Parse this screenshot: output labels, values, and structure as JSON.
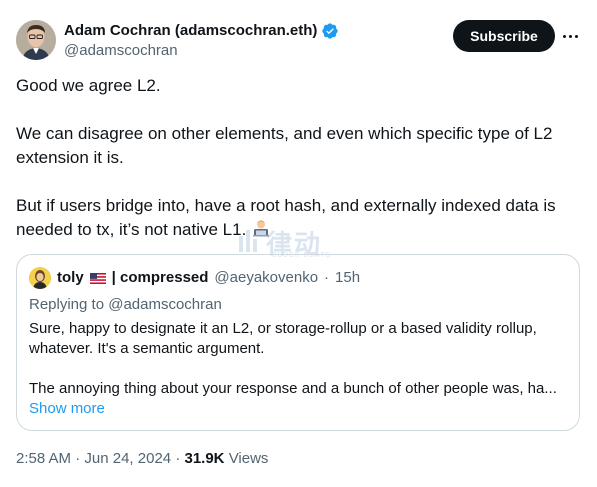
{
  "author": {
    "display_name": "Adam Cochran (adamscochran.eth)",
    "handle": "@adamscochran"
  },
  "actions": {
    "subscribe_label": "Subscribe"
  },
  "tweet": {
    "paragraphs": [
      "Good we agree L2.",
      "We can disagree on other elements, and even which specific type of L2 extension it is.",
      "But if users bridge into, have a root hash, and externally indexed data is needed to tx, it’s not native L1."
    ],
    "emoji": "man-technologist",
    "watermark_text": "律动",
    "watermark_sub": "BLOCK BEATS"
  },
  "quoted": {
    "display_name": "toly",
    "flag": "us-flag",
    "name_suffix": "| compressed",
    "handle": "@aeyakovenko",
    "separator": "·",
    "time": "15h",
    "replying_to": "Replying to @adamscochran",
    "paragraphs": [
      "Sure, happy to designate it an L2, or storage-rollup or a based validity rollup, whatever.  It's a semantic argument.",
      "The annoying thing about your response and a bunch of other people was, ha..."
    ],
    "show_more": "Show more"
  },
  "meta": {
    "time": "2:58 AM",
    "dot1": "·",
    "date": "Jun 24, 2024",
    "dot2": "·",
    "views_count": "31.9K",
    "views_label": "Views"
  },
  "colors": {
    "text": "#0f1419",
    "secondary": "#536471",
    "link": "#1d9bf0",
    "verified": "#1d9bf0",
    "button_bg": "#0f1419",
    "border": "#cfd9de"
  }
}
